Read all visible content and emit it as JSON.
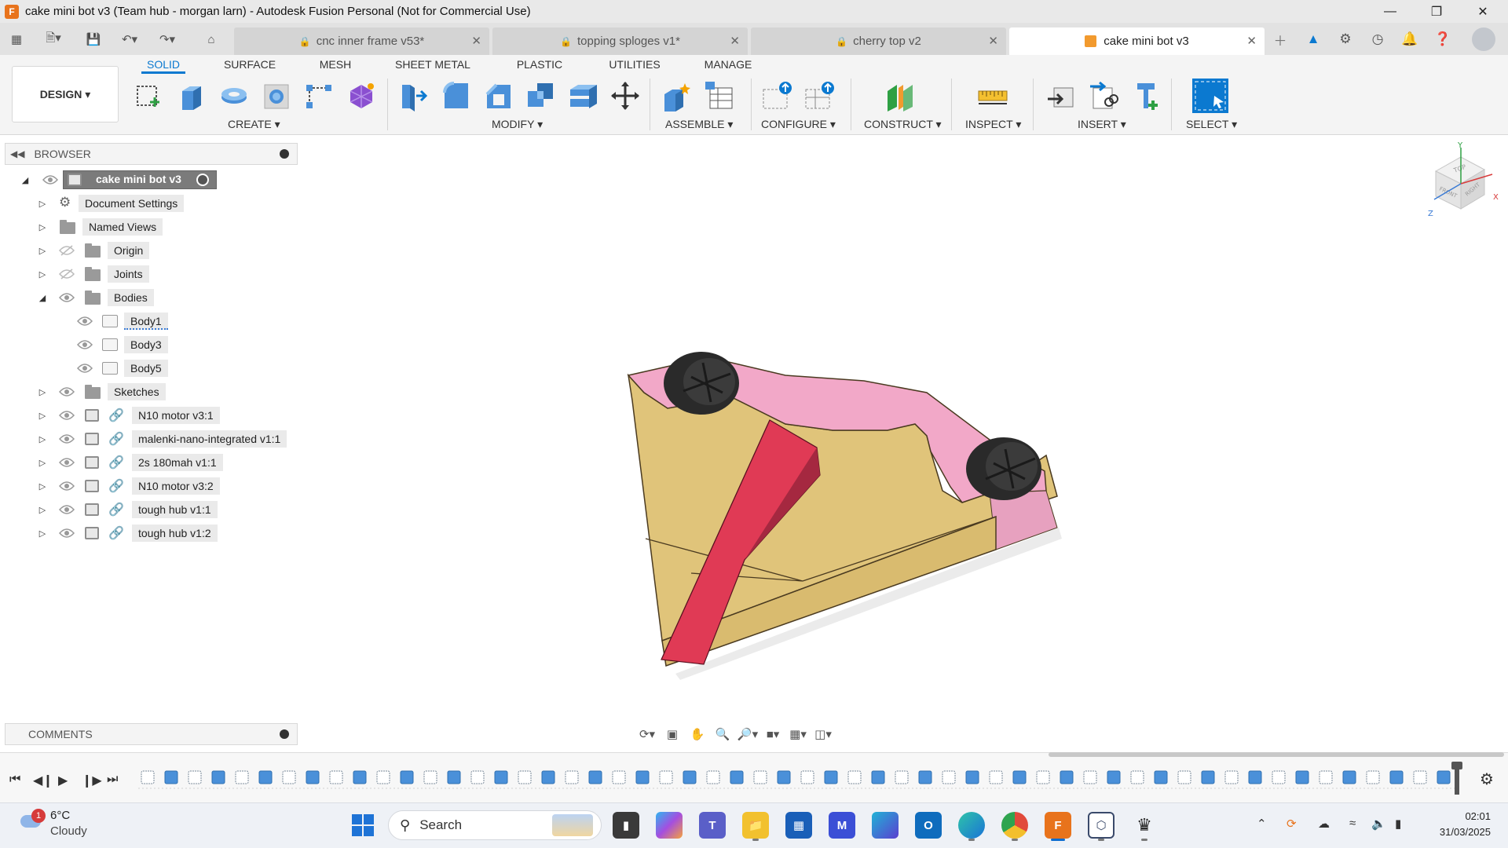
{
  "window": {
    "title": "cake mini bot v3 (Team hub - morgan larn) - Autodesk Fusion Personal (Not for Commercial Use)",
    "app_logo": "F"
  },
  "tabs": [
    {
      "label": "cnc inner frame v53*",
      "locked": true,
      "active": false
    },
    {
      "label": "topping sploges v1*",
      "locked": true,
      "active": false
    },
    {
      "label": "cherry top v2",
      "locked": true,
      "active": false
    },
    {
      "label": "cake mini bot v3",
      "locked": false,
      "active": true
    }
  ],
  "toolbar": {
    "workspace": "DESIGN",
    "workspace_tabs": [
      "SOLID",
      "SURFACE",
      "MESH",
      "SHEET METAL",
      "PLASTIC",
      "UTILITIES",
      "MANAGE"
    ],
    "groups": [
      "CREATE",
      "MODIFY",
      "ASSEMBLE",
      "CONFIGURE",
      "CONSTRUCT",
      "INSPECT",
      "INSERT",
      "SELECT"
    ]
  },
  "browser": {
    "header": "BROWSER",
    "root": "cake mini bot v3",
    "items": [
      {
        "label": "Document Settings",
        "icon": "gear-icon"
      },
      {
        "label": "Named Views",
        "icon": "folder-icon"
      },
      {
        "label": "Origin",
        "icon": "folder-icon"
      },
      {
        "label": "Joints",
        "icon": "folder-icon"
      },
      {
        "label": "Bodies",
        "icon": "folder-icon"
      },
      {
        "label": "Body1",
        "icon": "body-icon"
      },
      {
        "label": "Body3",
        "icon": "body-icon"
      },
      {
        "label": "Body5",
        "icon": "body-icon"
      },
      {
        "label": "Sketches",
        "icon": "folder-icon"
      },
      {
        "label": "N10 motor v3:1",
        "icon": "link-icon"
      },
      {
        "label": "malenki-nano-integrated v1:1",
        "icon": "link-icon"
      },
      {
        "label": "2s 180mah v1:1",
        "icon": "link-icon"
      },
      {
        "label": "N10 motor v3:2",
        "icon": "link-icon"
      },
      {
        "label": "tough hub v1:1",
        "icon": "link-icon"
      },
      {
        "label": "tough hub v1:2",
        "icon": "link-icon"
      }
    ]
  },
  "comments": {
    "header": "COMMENTS"
  },
  "viewcube": {
    "top": "TOP",
    "front": "FRONT",
    "right": "RIGHT",
    "axis_x": "X",
    "axis_y": "Y",
    "axis_z": "Z"
  },
  "taskbar": {
    "weather_temp": "6°C",
    "weather_desc": "Cloudy",
    "weather_badge": "1",
    "search_placeholder": "Search",
    "time": "02:01",
    "date": "31/03/2025"
  },
  "colors": {
    "accent": "#0b79d0",
    "body_base": "#e0c47a",
    "body_top": "#f2a8c8",
    "wedge": "#e03a55",
    "wheel": "#2a2a2a"
  }
}
